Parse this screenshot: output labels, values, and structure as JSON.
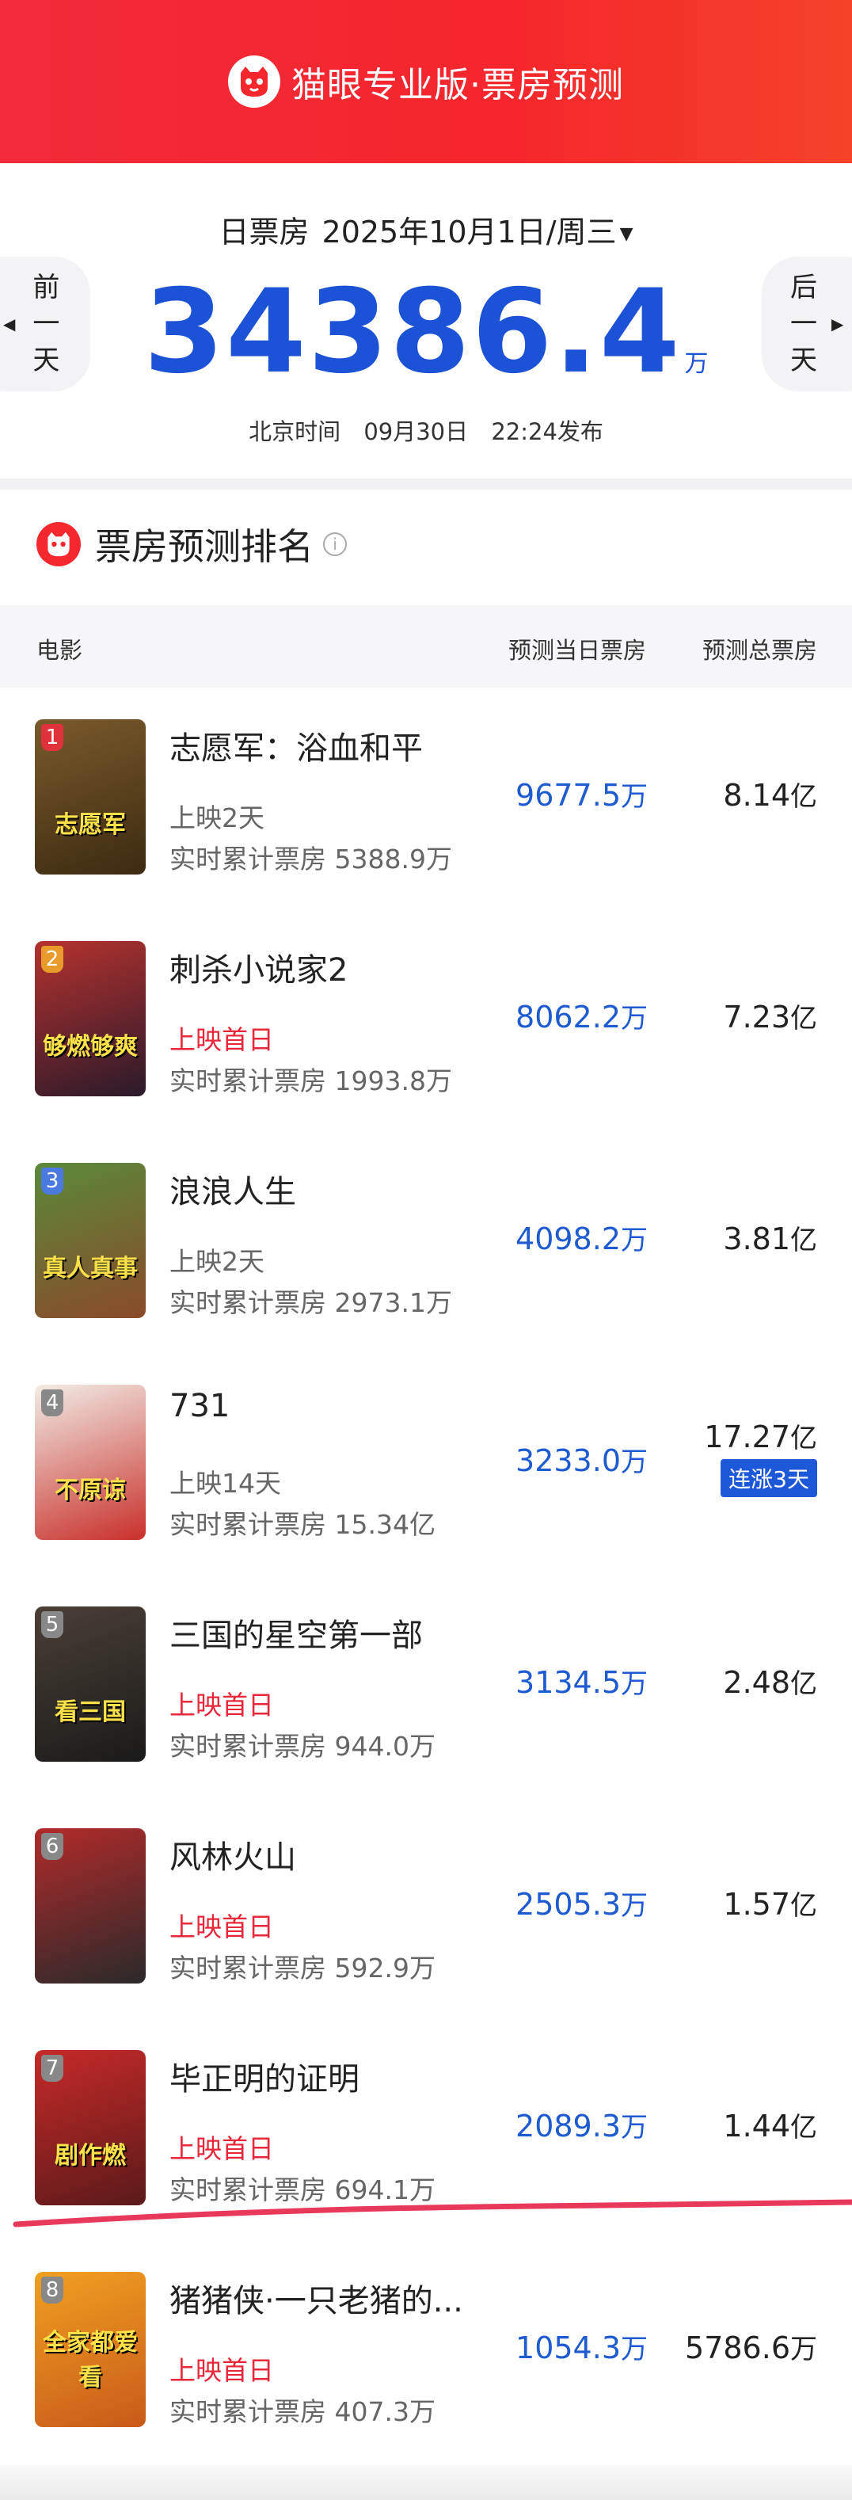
{
  "header": {
    "title": "猫眼专业版·票房预测"
  },
  "summary": {
    "label": "日票房",
    "date": "2025年10月1日/周三",
    "value": "34386.4",
    "unit": "万",
    "release_prefix": "北京时间",
    "release_date": "09月30日",
    "release_time": "22:24发布",
    "prev_label": [
      "前",
      "一",
      "天"
    ],
    "next_label": [
      "后",
      "一",
      "天"
    ]
  },
  "ranking": {
    "title": "票房预测排名",
    "columns": {
      "movie": "电影",
      "daily": "预测当日票房",
      "total": "预测总票房"
    },
    "rows": [
      {
        "rank": "1",
        "name": "志愿军：浴血和平",
        "status": "上映2天",
        "status_first": false,
        "accum": "实时累计票房 5388.9万",
        "daily": "9677.5",
        "daily_unit": "万",
        "total": "8.14",
        "total_unit": "亿",
        "badge": "",
        "poster_text": "志愿军",
        "poster_colors": [
          "#7a5a2a",
          "#3d2a12"
        ],
        "rank_color": "#e0323a"
      },
      {
        "rank": "2",
        "name": "刺杀小说家2",
        "status": "上映首日",
        "status_first": true,
        "accum": "实时累计票房 1993.8万",
        "daily": "8062.2",
        "daily_unit": "万",
        "total": "7.23",
        "total_unit": "亿",
        "badge": "",
        "poster_text": "够燃够爽",
        "poster_colors": [
          "#b5322e",
          "#2a1a2a"
        ],
        "rank_color": "#e89a2a"
      },
      {
        "rank": "3",
        "name": "浪浪人生",
        "status": "上映2天",
        "status_first": false,
        "accum": "实时累计票房 2973.1万",
        "daily": "4098.2",
        "daily_unit": "万",
        "total": "3.81",
        "total_unit": "亿",
        "badge": "",
        "poster_text": "真人真事",
        "poster_colors": [
          "#5a8a3a",
          "#8a4a2a"
        ],
        "rank_color": "#4a7ae0"
      },
      {
        "rank": "4",
        "name": "731",
        "status": "上映14天",
        "status_first": false,
        "accum": "实时累计票房 15.34亿",
        "daily": "3233.0",
        "daily_unit": "万",
        "total": "17.27",
        "total_unit": "亿",
        "badge": "连涨3天",
        "poster_text": "不原谅",
        "poster_colors": [
          "#f2ece6",
          "#c9302a"
        ],
        "rank_color": "#888888"
      },
      {
        "rank": "5",
        "name": "三国的星空第一部",
        "status": "上映首日",
        "status_first": true,
        "accum": "实时累计票房 944.0万",
        "daily": "3134.5",
        "daily_unit": "万",
        "total": "2.48",
        "total_unit": "亿",
        "badge": "",
        "poster_text": "看三国",
        "poster_colors": [
          "#4a4036",
          "#1a1a1a"
        ],
        "rank_color": "#888888"
      },
      {
        "rank": "6",
        "name": "风林火山",
        "status": "上映首日",
        "status_first": true,
        "accum": "实时累计票房 592.9万",
        "daily": "2505.3",
        "daily_unit": "万",
        "total": "1.57",
        "total_unit": "亿",
        "badge": "",
        "poster_text": "",
        "poster_colors": [
          "#b22a2a",
          "#2a2a2a"
        ],
        "rank_color": "#888888"
      },
      {
        "rank": "7",
        "name": "毕正明的证明",
        "status": "上映首日",
        "status_first": true,
        "accum": "实时累计票房 694.1万",
        "daily": "2089.3",
        "daily_unit": "万",
        "total": "1.44",
        "total_unit": "亿",
        "badge": "",
        "poster_text": "剧作燃",
        "poster_colors": [
          "#c62a28",
          "#5a1a1a"
        ],
        "rank_color": "#888888"
      },
      {
        "rank": "8",
        "name": "猪猪侠·一只老猪的...",
        "status": "上映首日",
        "status_first": true,
        "accum": "实时累计票房 407.3万",
        "daily": "1054.3",
        "daily_unit": "万",
        "total": "5786.6",
        "total_unit": "万",
        "badge": "",
        "poster_text": "全家都爱看",
        "poster_colors": [
          "#f0a020",
          "#c85a1a"
        ],
        "rank_color": "#888888"
      }
    ]
  },
  "accent_colors": {
    "brand_red": "#f5262c",
    "blue": "#1b52d6",
    "first_day_red": "#e8283a"
  }
}
